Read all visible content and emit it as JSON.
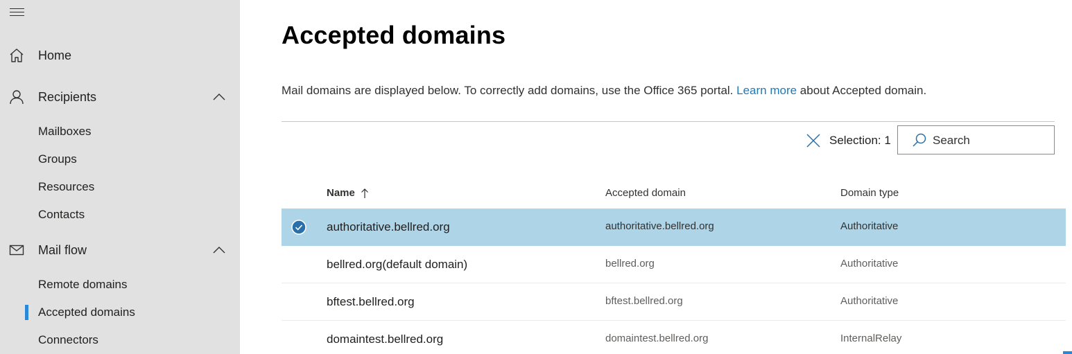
{
  "sidebar": {
    "menu_icon": "hamburger-icon",
    "sections": [
      {
        "label": "Home",
        "icon": "home-icon"
      },
      {
        "label": "Recipients",
        "icon": "person-icon",
        "expanded": true,
        "items": [
          "Mailboxes",
          "Groups",
          "Resources",
          "Contacts"
        ]
      },
      {
        "label": "Mail flow",
        "icon": "mail-icon",
        "expanded": true,
        "items": [
          "Remote domains",
          "Accepted domains",
          "Connectors"
        ]
      }
    ],
    "selected_item": "Accepted domains"
  },
  "main": {
    "title": "Accepted domains",
    "description_prefix": "Mail domains are displayed below. To correctly add domains, use the Office 365 portal. ",
    "description_link": "Learn more",
    "description_suffix": " about Accepted domain.",
    "toolbar": {
      "clear_icon": "close-icon",
      "selection_label": "Selection: 1",
      "search_placeholder": "Search",
      "search_icon": "search-icon"
    },
    "table": {
      "columns": {
        "name": "Name",
        "accepted_domain": "Accepted domain",
        "domain_type": "Domain type"
      },
      "sort_icon": "arrow-up-icon",
      "rows": [
        {
          "name": "authoritative.bellred.org",
          "accepted_domain": "authoritative.bellred.org",
          "domain_type": "Authoritative",
          "selected": true
        },
        {
          "name": "bellred.org(default domain)",
          "accepted_domain": "bellred.org",
          "domain_type": "Authoritative",
          "selected": false
        },
        {
          "name": "bftest.bellred.org",
          "accepted_domain": "bftest.bellred.org",
          "domain_type": "Authoritative",
          "selected": false
        },
        {
          "name": "domaintest.bellred.org",
          "accepted_domain": "domaintest.bellred.org",
          "domain_type": "InternalRelay",
          "selected": false
        }
      ]
    }
  },
  "colors": {
    "sidebar_bg": "#e1e1e1",
    "selected_row_bg": "#aed4e8",
    "accent": "#2b88d8",
    "link": "#1f7ab5"
  }
}
